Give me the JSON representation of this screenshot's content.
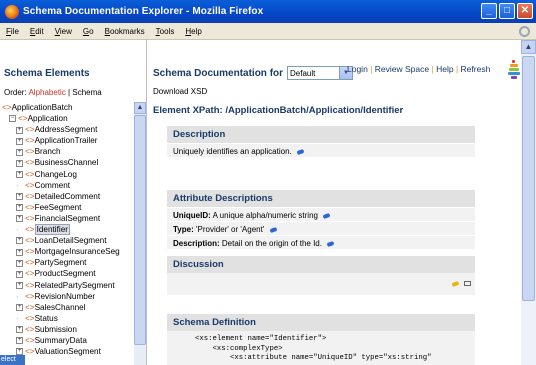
{
  "window": {
    "title": "Schema Documentation Explorer - Mozilla Firefox"
  },
  "menu": [
    "File",
    "Edit",
    "View",
    "Go",
    "Bookmarks",
    "Tools",
    "Help"
  ],
  "sidebar": {
    "title": "Schema Elements",
    "order_label": "Order:",
    "order_alphabetic": "Alphabetic",
    "order_sep": "|",
    "order_schema": "Schema",
    "tree": [
      {
        "indent": 0,
        "toggle": "",
        "text": "ApplicationBatch",
        "selected": false
      },
      {
        "indent": 1,
        "toggle": "⊟",
        "text": "Application",
        "selected": false
      },
      {
        "indent": 2,
        "toggle": "⊞",
        "text": "AddressSegment",
        "selected": false
      },
      {
        "indent": 2,
        "toggle": "⊞",
        "text": "ApplicationTrailer",
        "selected": false
      },
      {
        "indent": 2,
        "toggle": "⊞",
        "text": "Branch",
        "selected": false
      },
      {
        "indent": 2,
        "toggle": "⊞",
        "text": "BusinessChannel",
        "selected": false
      },
      {
        "indent": 2,
        "toggle": "⊞",
        "text": "ChangeLog",
        "selected": false
      },
      {
        "indent": 2,
        "toggle": "",
        "text": "Comment",
        "selected": false
      },
      {
        "indent": 2,
        "toggle": "⊞",
        "text": "DetailedComment",
        "selected": false
      },
      {
        "indent": 2,
        "toggle": "⊞",
        "text": "FeeSegment",
        "selected": false
      },
      {
        "indent": 2,
        "toggle": "⊞",
        "text": "FinancialSegment",
        "selected": false
      },
      {
        "indent": 2,
        "toggle": "",
        "text": "Identifier",
        "selected": true
      },
      {
        "indent": 2,
        "toggle": "⊞",
        "text": "LoanDetailSegment",
        "selected": false
      },
      {
        "indent": 2,
        "toggle": "⊞",
        "text": "MortgageInsuranceSeg",
        "selected": false
      },
      {
        "indent": 2,
        "toggle": "⊞",
        "text": "PartySegment",
        "selected": false
      },
      {
        "indent": 2,
        "toggle": "⊞",
        "text": "ProductSegment",
        "selected": false
      },
      {
        "indent": 2,
        "toggle": "⊞",
        "text": "RelatedPartySegment",
        "selected": false
      },
      {
        "indent": 2,
        "toggle": "",
        "text": "RevisionNumber",
        "selected": false
      },
      {
        "indent": 2,
        "toggle": "⊞",
        "text": "SalesChannel",
        "selected": false
      },
      {
        "indent": 2,
        "toggle": "",
        "text": "Status",
        "selected": false
      },
      {
        "indent": 2,
        "toggle": "⊞",
        "text": "Submission",
        "selected": false
      },
      {
        "indent": 2,
        "toggle": "⊞",
        "text": "SummaryData",
        "selected": false
      },
      {
        "indent": 2,
        "toggle": "⊞",
        "text": "ValuationSegment",
        "selected": false
      }
    ],
    "status_tab": "elect"
  },
  "main": {
    "doc_for_label": "Schema Documentation for",
    "select_value": "Default",
    "links": {
      "login": "Login",
      "review": "Review Space",
      "help": "Help",
      "refresh": "Refresh",
      "sep": "|"
    },
    "download": "Download XSD",
    "xpath": "Element XPath: /ApplicationBatch/Application/Identifier",
    "description": {
      "title": "Description",
      "text": "Uniquely identifies an application."
    },
    "attributes": {
      "title": "Attribute Descriptions",
      "rows": [
        {
          "label": "UniqueID:",
          "text": "A unique alpha/numeric string"
        },
        {
          "label": "Type:",
          "text": "'Provider' or 'Agent'"
        },
        {
          "label": "Description:",
          "text": "Detail on the origin of the Id."
        }
      ]
    },
    "discussion": {
      "title": "Discussion"
    },
    "schema_def": {
      "title": "Schema Definition",
      "lines": [
        "<xs:element name=\"Identifier\">",
        "    <xs:complexType>",
        "        <xs:attribute name=\"UniqueID\" type=\"xs:string\""
      ]
    }
  },
  "colors": {
    "accent_link": "#c8332b",
    "heading": "#1a3a6a",
    "tag": "#d05a1a"
  }
}
